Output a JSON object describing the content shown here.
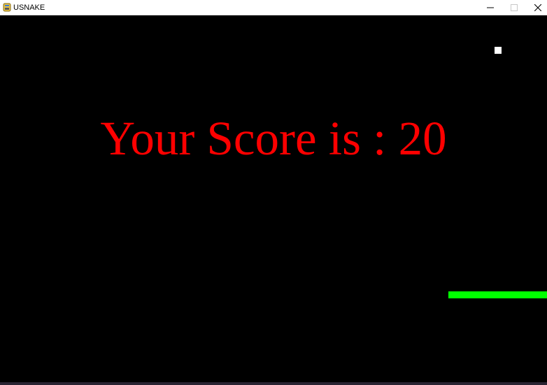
{
  "window": {
    "title": "USNAKE",
    "icon": "pygame-snake-icon",
    "controls": {
      "minimize_icon": "minimize-icon",
      "maximize_icon": "maximize-icon",
      "close_icon": "close-icon",
      "enabled_color": "#000000",
      "disabled_color": "#c8c8c8"
    }
  },
  "game": {
    "background_color": "#000000",
    "score_message": "Your Score is : 20",
    "score_color": "#ff0000",
    "food_color": "#ffffff",
    "snake_color": "#00ff00"
  }
}
